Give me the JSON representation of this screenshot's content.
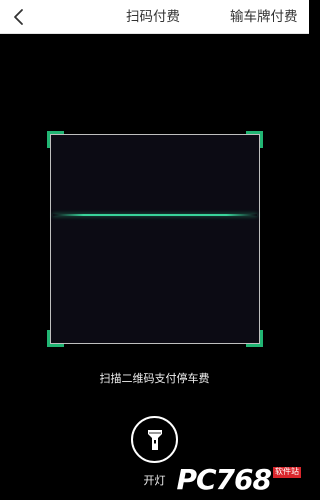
{
  "header": {
    "back_icon": "chevron-left-icon",
    "tabs": [
      {
        "label": "扫码付费"
      },
      {
        "label": "输车牌付费"
      }
    ]
  },
  "scanner": {
    "hint": "扫描二维码支付停车费",
    "frame_corner_color": "#21b573",
    "scan_line_color": "#39d39a"
  },
  "flashlight": {
    "icon": "flashlight-icon",
    "label": "开灯"
  },
  "watermark": {
    "logo": "PC768",
    "tag": "软件站"
  }
}
